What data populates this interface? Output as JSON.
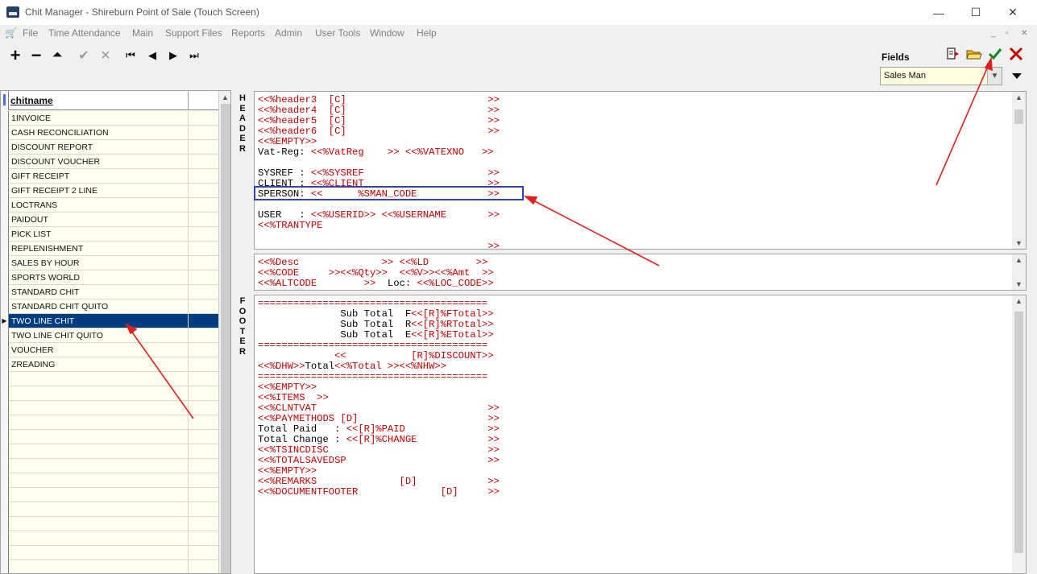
{
  "window": {
    "title": "Chit Manager - Shireburn Point of Sale (Touch Screen)",
    "minimize": "—",
    "maximize": "☐",
    "close": "✕"
  },
  "menu": {
    "items": [
      "File",
      "Time Attendance",
      "Main",
      "Support Files",
      "Reports",
      "Admin",
      "User Tools",
      "Window",
      "Help"
    ],
    "mdi_min": "_",
    "mdi_restore": "▫",
    "mdi_close": "✕"
  },
  "toolbar": {
    "add": "+",
    "remove": "−",
    "up": "⏶",
    "confirm": "✔",
    "cancel": "✕",
    "first": "⏮",
    "prev": "◀",
    "next": "▶",
    "last": "⏭"
  },
  "fields": {
    "label": "Fields",
    "selected": "Sales Man",
    "insert_icon": "insert-field-icon",
    "open_icon": "open-folder-icon",
    "ok_icon": "green-check-icon",
    "close_icon": "red-x-icon"
  },
  "grid": {
    "column_header": "chitname",
    "rows": [
      "1INVOICE",
      "CASH RECONCILIATION",
      "DISCOUNT REPORT",
      "DISCOUNT VOUCHER",
      "GIFT RECEIPT",
      "GIFT RECEIPT 2 LINE",
      "LOCTRANS",
      "PAIDOUT",
      "PICK LIST",
      "REPLENISHMENT",
      "SALES BY HOUR",
      "SPORTS WORLD",
      "STANDARD CHIT",
      "STANDARD CHIT QUITO",
      "TWO LINE CHIT",
      "TWO LINE CHIT QUITO",
      "VOUCHER",
      "ZREADING"
    ],
    "selected_index": 14,
    "row_marker": "▶"
  },
  "labels": {
    "header": [
      "H",
      "E",
      "A",
      "D",
      "E",
      "R"
    ],
    "footer": [
      "F",
      "O",
      "O",
      "T",
      "E",
      "R"
    ]
  },
  "header_text": [
    "<<%header3  [C]                        >>",
    "<<%header4  [C]                        >>",
    "<<%header5  [C]                        >>",
    "<<%header6  [C]                        >>",
    "<<%EMPTY>>",
    "Vat-Reg: <<%VatReg    >> <<%VATEXNO   >>",
    "",
    "SYSREF : <<%SYSREF                     >>",
    "CLIENT : <<%CLIENT                     >>",
    "SPERSON: <<      %SMAN_CODE            >>",
    "",
    "USER   : <<%USERID>> <<%USERNAME       >>",
    "<<%TRANTYPE",
    "",
    "                                       >>"
  ],
  "detail_text": [
    "<<%Desc              >> <<%LD        >>",
    "<<%CODE     >><<%Qty>>  <<%V>><<%Amt  >>",
    "<<%ALTCODE        >>  Loc: <<%LOC_CODE>>"
  ],
  "footer_text": [
    "=======================================",
    "              Sub Total  F<<[R]%FTotal>>",
    "              Sub Total  R<<[R]%RTotal>>",
    "              Sub Total  E<<[R]%ETotal>>",
    "=======================================",
    "             <<           [R]%DISCOUNT>>",
    "<<%DHW>>Total<<%Total >><<%NHW>>",
    "=======================================",
    "<<%EMPTY>>",
    "<<%ITEMS  >>",
    "<<%CLNTVAT                             >>",
    "<<%PAYMETHODS [D]                      >>",
    "Total Paid   : <<[R]%PAID              >>",
    "Total Change : <<[R]%CHANGE            >>",
    "<<%TSINCDISC                           >>",
    "<<%TOTALSAVEDSP                        >>",
    "<<%EMPTY>>",
    "<<%REMARKS              [D]            >>",
    "<<%DOCUMENTFOOTER              [D]     >>"
  ],
  "colors": {
    "selection": "#003c80",
    "template_text": "#c00000",
    "annotation": "#e02020",
    "highlight": "#3040c0"
  }
}
